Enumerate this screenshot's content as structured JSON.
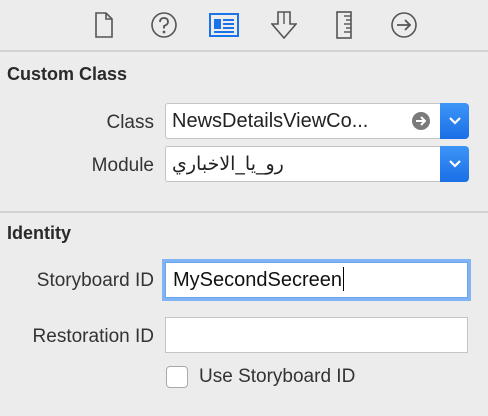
{
  "toolbar": {
    "icons": [
      {
        "name": "file-inspector-icon"
      },
      {
        "name": "quick-help-icon"
      },
      {
        "name": "identity-inspector-icon",
        "selected": true
      },
      {
        "name": "attributes-inspector-icon"
      },
      {
        "name": "size-inspector-icon"
      },
      {
        "name": "connections-inspector-icon"
      }
    ],
    "accent_color": "#1a73e8"
  },
  "custom_class": {
    "section_title": "Custom Class",
    "class_label": "Class",
    "class_value": "NewsDetailsViewCo...",
    "module_label": "Module",
    "module_value": "رو_يا_الاخباري"
  },
  "identity": {
    "section_title": "Identity",
    "storyboard_id_label": "Storyboard ID",
    "storyboard_id_value": "MySecondSecreen",
    "restoration_id_label": "Restoration ID",
    "restoration_id_value": "",
    "use_storyboard_id_label": "Use Storyboard ID",
    "use_storyboard_id_checked": false
  }
}
